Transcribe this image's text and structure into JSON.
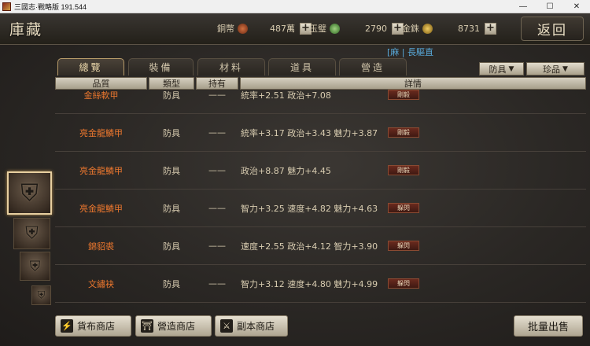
{
  "window": {
    "title": "三國志·戰略版 191.544",
    "controls": [
      "—",
      "☐",
      "✕"
    ]
  },
  "header": {
    "title": "庫藏",
    "currencies": [
      {
        "label": "銅幣",
        "value": "487萬",
        "color": "#b0502a"
      },
      {
        "label": "玉璧",
        "value": "2790",
        "color": "#5aa04a"
      },
      {
        "label": "金銖",
        "value": "8731",
        "color": "#c89a30"
      }
    ],
    "plus_label": "+",
    "back_label": "返回"
  },
  "ticker": "[麻 | 長驅直",
  "tabs": [
    {
      "label": "總覽",
      "active": true
    },
    {
      "label": "裝備",
      "active": false
    },
    {
      "label": "材料",
      "active": false
    },
    {
      "label": "道具",
      "active": false
    },
    {
      "label": "營造",
      "active": false
    }
  ],
  "filters": [
    {
      "label": "防具",
      "arrow": "▼"
    },
    {
      "label": "珍品",
      "arrow": "▼"
    }
  ],
  "table": {
    "headers": [
      "品質",
      "類型",
      "持有",
      "詳情"
    ],
    "rows": [
      {
        "name": "金絲軟甲",
        "type": "防具",
        "held": "——",
        "detail": "統率+2.51 政治+7.08",
        "button": "剛毅"
      },
      {
        "name": "亮金龍鱗甲",
        "type": "防具",
        "held": "——",
        "detail": "統率+3.17 政治+3.43 魅力+3.87",
        "button": "剛毅"
      },
      {
        "name": "亮金龍鱗甲",
        "type": "防具",
        "held": "——",
        "detail": "政治+8.87 魅力+4.45",
        "button": "剛毅"
      },
      {
        "name": "亮金龍鱗甲",
        "type": "防具",
        "held": "——",
        "detail": "智力+3.25 速度+4.82 魅力+4.63",
        "button": "躲閃"
      },
      {
        "name": "錦貂裘",
        "type": "防具",
        "held": "——",
        "detail": "速度+2.55 政治+4.12 智力+3.90",
        "button": "躲閃"
      },
      {
        "name": "文繡袂",
        "type": "防具",
        "held": "——",
        "detail": "智力+3.12 速度+4.80 魅力+4.99",
        "button": "躲閃"
      }
    ]
  },
  "bottom": {
    "buttons": [
      {
        "label": "貨布商店",
        "icon": "⚡"
      },
      {
        "label": "營造商店",
        "icon": "⛩"
      },
      {
        "label": "副本商店",
        "icon": "⚔"
      }
    ],
    "sell_label": "批量出售"
  }
}
